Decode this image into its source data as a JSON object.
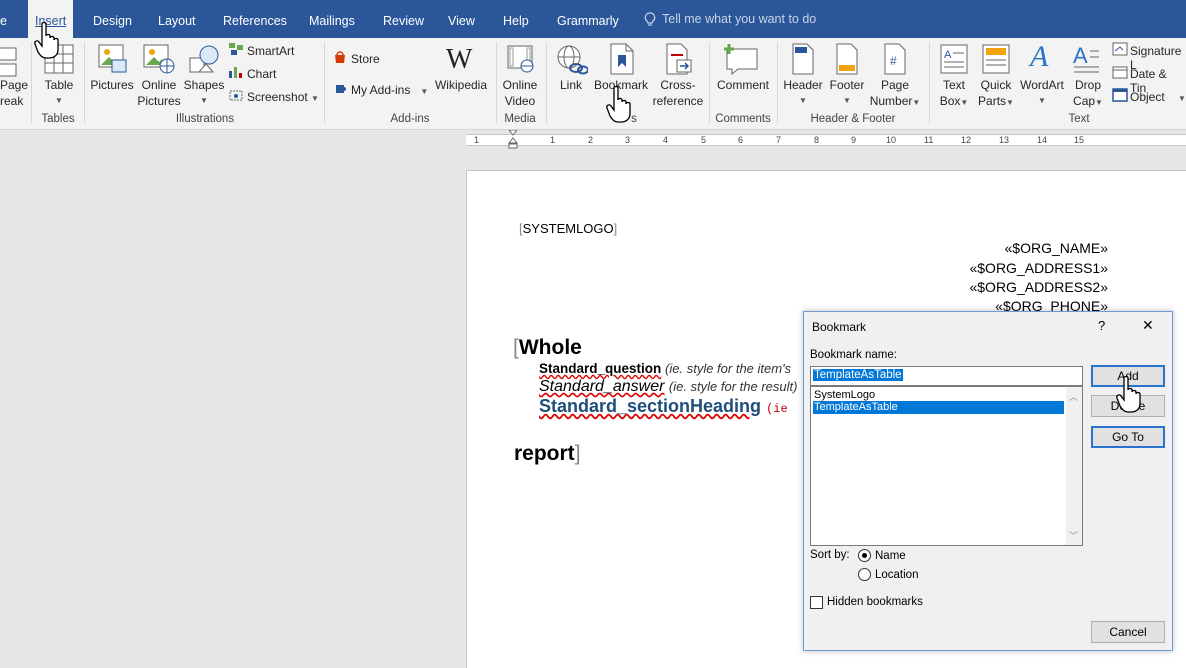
{
  "tabs": [
    "e",
    "Insert",
    "Design",
    "Layout",
    "References",
    "Mailings",
    "Review",
    "View",
    "Help",
    "Grammarly"
  ],
  "tell_me": "Tell me what you want to do",
  "ribbon": {
    "page_break": [
      "Page",
      "reak"
    ],
    "table": "Table",
    "tables_group": "Tables",
    "pictures": "Pictures",
    "online_pictures": [
      "Online",
      "Pictures"
    ],
    "shapes": "Shapes",
    "smartart": "SmartArt",
    "chart": "Chart",
    "screenshot": "Screenshot",
    "illustrations_group": "Illustrations",
    "store": "Store",
    "my_addins": "My Add-ins",
    "wikipedia": "Wikipedia",
    "addins_group": "Add-ins",
    "online_video": [
      "Online",
      "Video"
    ],
    "media_group": "Media",
    "link": "Link",
    "bookmark": "Bookmark",
    "cross_reference": [
      "Cross-",
      "reference"
    ],
    "links_group": "s",
    "comment": "Comment",
    "comments_group": "Comments",
    "header": "Header",
    "footer": "Footer",
    "page_number": [
      "Page",
      "Number"
    ],
    "header_footer_group": "Header & Footer",
    "text_box": [
      "Text",
      "Box"
    ],
    "quick_parts": [
      "Quick",
      "Parts"
    ],
    "wordart": "WordArt",
    "drop_cap": [
      "Drop",
      "Cap"
    ],
    "signature": "Signature L",
    "date_time": "Date & Tin",
    "object": "Object",
    "text_group": "Text"
  },
  "ruler": [
    "1",
    "1",
    "2",
    "3",
    "4",
    "5",
    "6",
    "7",
    "8",
    "9",
    "10",
    "11",
    "12",
    "13",
    "14",
    "15"
  ],
  "document": {
    "systemlogo": "SYSTEMLOGO",
    "org_name": "«$ORG_NAME»",
    "org_address1": "«$ORG_ADDRESS1»",
    "org_address2": "«$ORG_ADDRESS2»",
    "org_phone": "«$ORG_PHONE»",
    "whole": "Whole",
    "std_question": "Standard_question",
    "std_question_note": "(ie. style for the item's",
    "std_answer": "Standard_answer",
    "std_answer_note": "(ie. style for the result)",
    "std_heading": "Standard_sectionHeading",
    "std_heading_note": "(ie",
    "report": "report"
  },
  "dialog": {
    "title": "Bookmark",
    "help": "?",
    "close": "✕",
    "name_label": "Bookmark name:",
    "name_value": "TemplateAsTable",
    "items": [
      "SystemLogo",
      "TemplateAsTable"
    ],
    "add": "Add",
    "delete": "Delete",
    "goto": "Go To",
    "sort_by": "Sort by:",
    "sort_name": "Name",
    "sort_location": "Location",
    "hidden": "Hidden bookmarks",
    "cancel": "Cancel"
  },
  "colors": {
    "accent": "#2b579a",
    "selection": "#0078d7",
    "heading_blue": "#1f4e79"
  }
}
